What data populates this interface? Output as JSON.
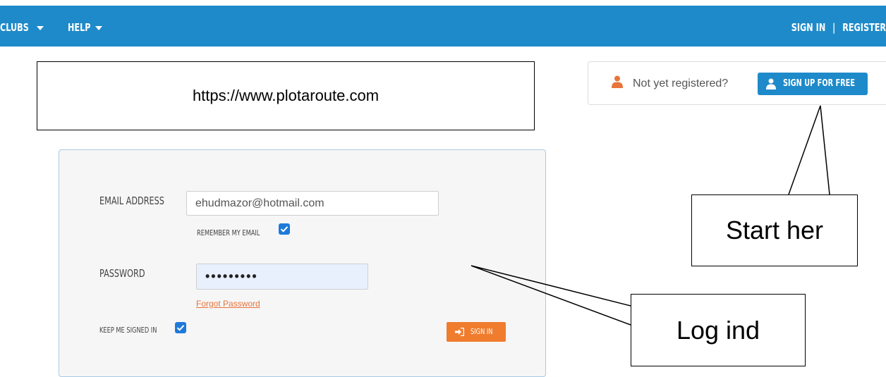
{
  "nav": {
    "clubs_label": "CLUBS",
    "help_label": "HELP",
    "sign_in_label": "SIGN IN",
    "separator": "|",
    "register_label": "REGISTER"
  },
  "url_annotation": {
    "text": "https://www.plotaroute.com"
  },
  "register_prompt": {
    "text": "Not yet registered?",
    "signup_button_label": "SIGN UP FOR FREE"
  },
  "login_form": {
    "email_label": "EMAIL ADDRESS",
    "email_value": "ehudmazor@hotmail.com",
    "remember_email_label": "REMEMBER MY EMAIL",
    "remember_email_checked": true,
    "password_label": "PASSWORD",
    "password_value": "•••••••••",
    "forgot_password_label": "Forgot Password",
    "keep_signed_in_label": "KEEP ME SIGNED IN",
    "keep_signed_in_checked": true,
    "sign_in_button_label": "SIGN IN"
  },
  "callouts": {
    "start_label": "Start her",
    "login_label": "Log ind"
  },
  "colors": {
    "topbar": "#1e8ac9",
    "primary_button": "#1e8ac9",
    "sign_in_button": "#f07c2e",
    "forgot_link": "#e8743b",
    "person_icon": "#e8743b",
    "checkbox": "#1e7ad9"
  },
  "icons": {
    "nav_caret": "chevron-down-icon",
    "register_prompt": "person-icon",
    "signup_button": "user-icon",
    "sign_in_button": "sign-in-icon",
    "checkbox": "checkmark-icon"
  }
}
